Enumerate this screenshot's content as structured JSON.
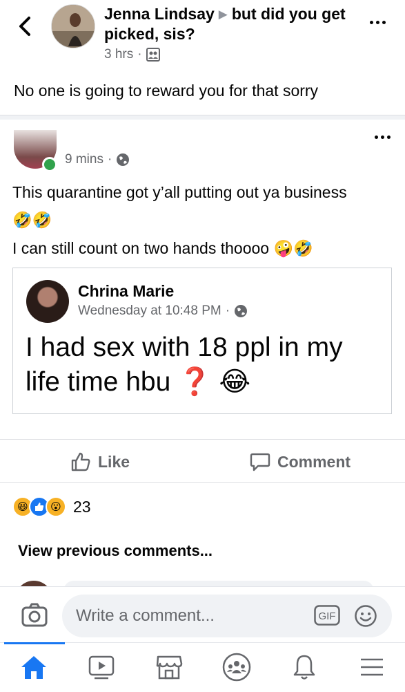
{
  "header": {
    "author": "Jenna Lindsay",
    "group": "but did you get picked, sis?",
    "time": "3 hrs",
    "audience_icon": "group-icon"
  },
  "post_text": "No one is going to reward you for that sorry",
  "shared_post": {
    "time": "9 mins",
    "privacy_icon": "globe-icon",
    "line1": "This quarantine got y’all putting out ya business",
    "line1_emoji": "🤣🤣",
    "line2": "I can still count on two hands thoooo",
    "line2_emoji": "🤪🤣",
    "quoted": {
      "name": "Chrina Marie",
      "time": "Wednesday at 10:48 PM",
      "text": "I had sex with 18 ppl in my life time hbu",
      "qmark": "❓",
      "emoji": "😂"
    }
  },
  "actions": {
    "like": "Like",
    "comment": "Comment"
  },
  "reactions": {
    "icons": [
      "haha",
      "like",
      "wow"
    ],
    "count": "23"
  },
  "view_previous": "View previous comments...",
  "composer": {
    "placeholder": "Write a comment...",
    "gif": "GIF"
  },
  "nav": [
    "home",
    "watch",
    "marketplace",
    "groups",
    "notifications",
    "menu"
  ],
  "colors": {
    "accent": "#1877f2",
    "secondary_text": "#65676b",
    "online": "#31a24c"
  }
}
